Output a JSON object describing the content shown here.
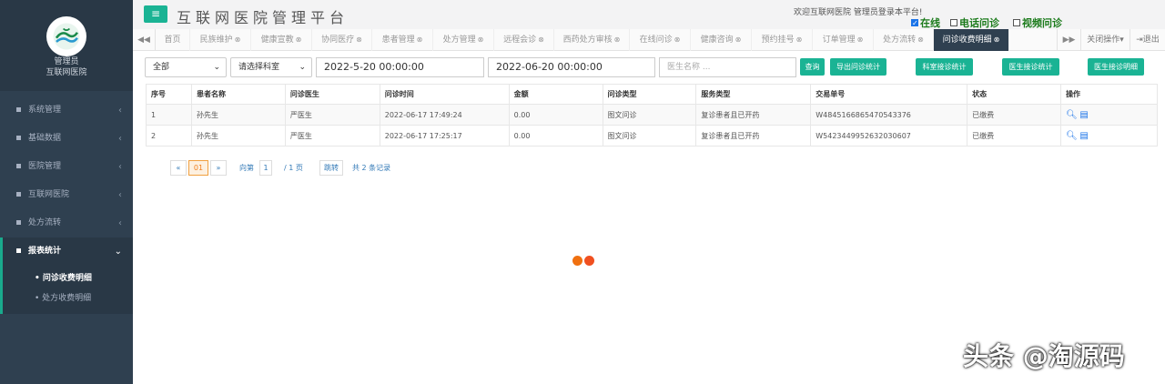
{
  "sidebar": {
    "role": "管理员",
    "org": "互联网医院",
    "menu": [
      {
        "label": "系统管理"
      },
      {
        "label": "基础数据"
      },
      {
        "label": "医院管理"
      },
      {
        "label": "互联网医院"
      },
      {
        "label": "处方流转"
      },
      {
        "label": "报表统计"
      }
    ],
    "submenu": [
      {
        "label": "• 问诊收费明细"
      },
      {
        "label": "• 处方收费明细"
      }
    ]
  },
  "header": {
    "menu_icon": "≡",
    "title": "互联网医院管理平台",
    "welcome": "欢迎互联网医院 管理员登录本平台!",
    "checks": [
      {
        "label": "在线",
        "checked": true
      },
      {
        "label": "电话问诊",
        "checked": false
      },
      {
        "label": "视频问诊",
        "checked": false
      }
    ]
  },
  "tabs": {
    "items": [
      "首页",
      "民族维护",
      "健康宣教",
      "协同医疗",
      "患者管理",
      "处方管理",
      "远程会诊",
      "西药处方审核",
      "在线问诊",
      "健康咨询",
      "预约挂号",
      "订单管理",
      "处方流转",
      "问诊收费明细"
    ],
    "close_ops": "关闭操作▾",
    "exit": "退出"
  },
  "filters": {
    "type": "全部",
    "dept": "请选择科室",
    "start": "2022-5-20 00:00:00",
    "end": "2022-06-20 00:00:00",
    "doctor_placeholder": "医生名称 ...",
    "buttons": [
      "查询",
      "导出问诊统计",
      "科室接诊统计",
      "医生接诊统计",
      "医生接诊明细"
    ]
  },
  "table": {
    "headers": [
      "序号",
      "患者名称",
      "问诊医生",
      "问诊时间",
      "金额",
      "问诊类型",
      "服务类型",
      "交易单号",
      "状态",
      "操作"
    ],
    "rows": [
      [
        "1",
        "孙先生",
        "严医生",
        "2022-06-17 17:49:24",
        "0.00",
        "图文问诊",
        "复诊患者且已开药",
        "W4845166865470543376",
        "已缴费"
      ],
      [
        "2",
        "孙先生",
        "严医生",
        "2022-06-17 17:25:17",
        "0.00",
        "图文问诊",
        "复诊患者且已开药",
        "W5423449952632030607",
        "已缴费"
      ]
    ]
  },
  "pager": {
    "prev": "«",
    "current": "01",
    "next": "»",
    "goto_label": "向第",
    "page_input": "1",
    "total_pages": "/ 1 页",
    "jump": "跳转",
    "total_records": "共 2 条记录"
  },
  "watermark": "头条 @淘源码",
  "colors": {
    "accent": "#1ab394",
    "sidebar": "#2f4050",
    "status": "#e02020",
    "loader1": "#f07010",
    "loader2": "#f05020"
  }
}
